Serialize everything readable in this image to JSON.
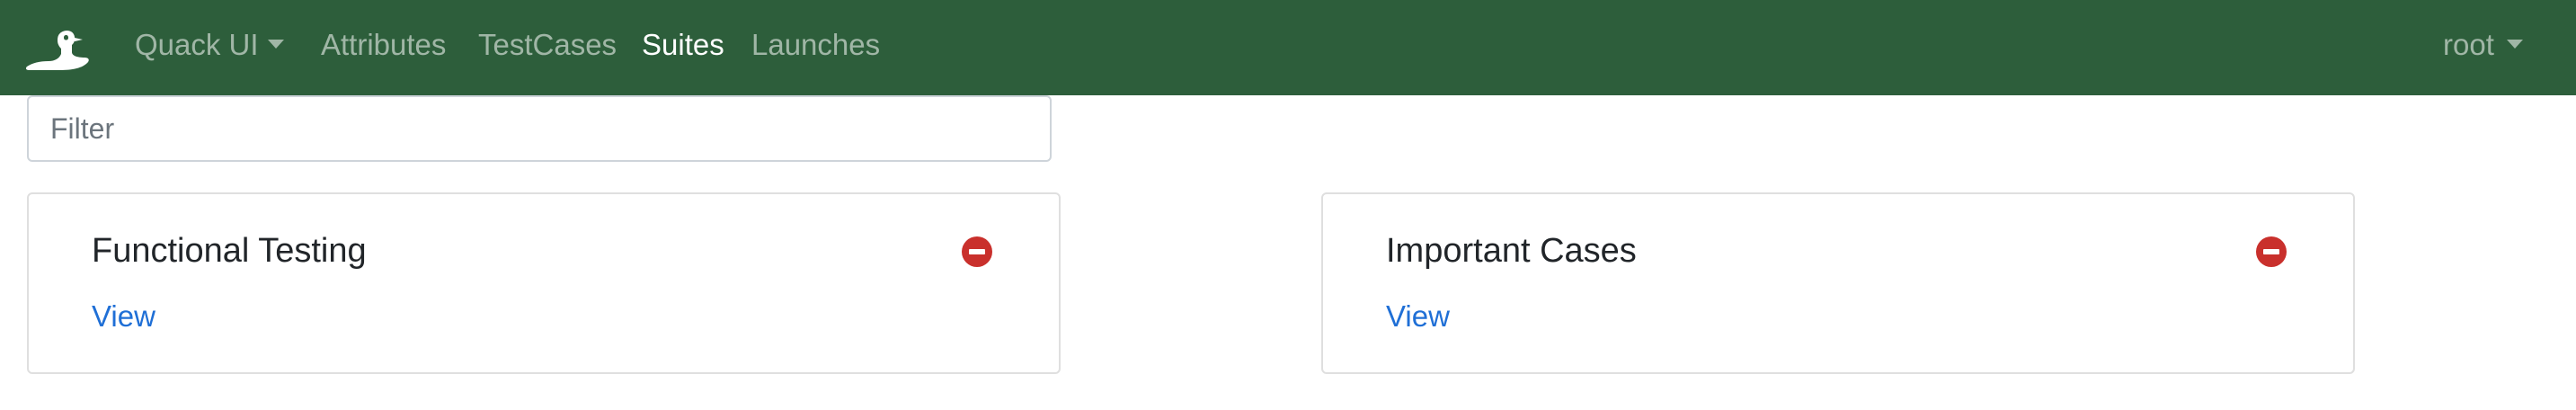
{
  "navbar": {
    "logo_icon": "duck-logo-icon",
    "brand_label": "Quack UI",
    "links": [
      {
        "label": "Attributes",
        "active": false
      },
      {
        "label": "TestCases",
        "active": false
      },
      {
        "label": "Suites",
        "active": true
      },
      {
        "label": "Launches",
        "active": false
      }
    ],
    "user_label": "root",
    "background": "#2d5e3b"
  },
  "filter": {
    "placeholder": "Filter",
    "value": ""
  },
  "suites": [
    {
      "title": "Functional Testing",
      "link_label": "View",
      "remove_icon": "remove-circle-icon"
    },
    {
      "title": "Important Cases",
      "link_label": "View",
      "remove_icon": "remove-circle-icon"
    }
  ],
  "colors": {
    "link": "#1f6fd6",
    "danger": "#c9302c",
    "active_nav": "#ffffff",
    "inactive_nav": "rgba(255,255,255,0.55)"
  }
}
